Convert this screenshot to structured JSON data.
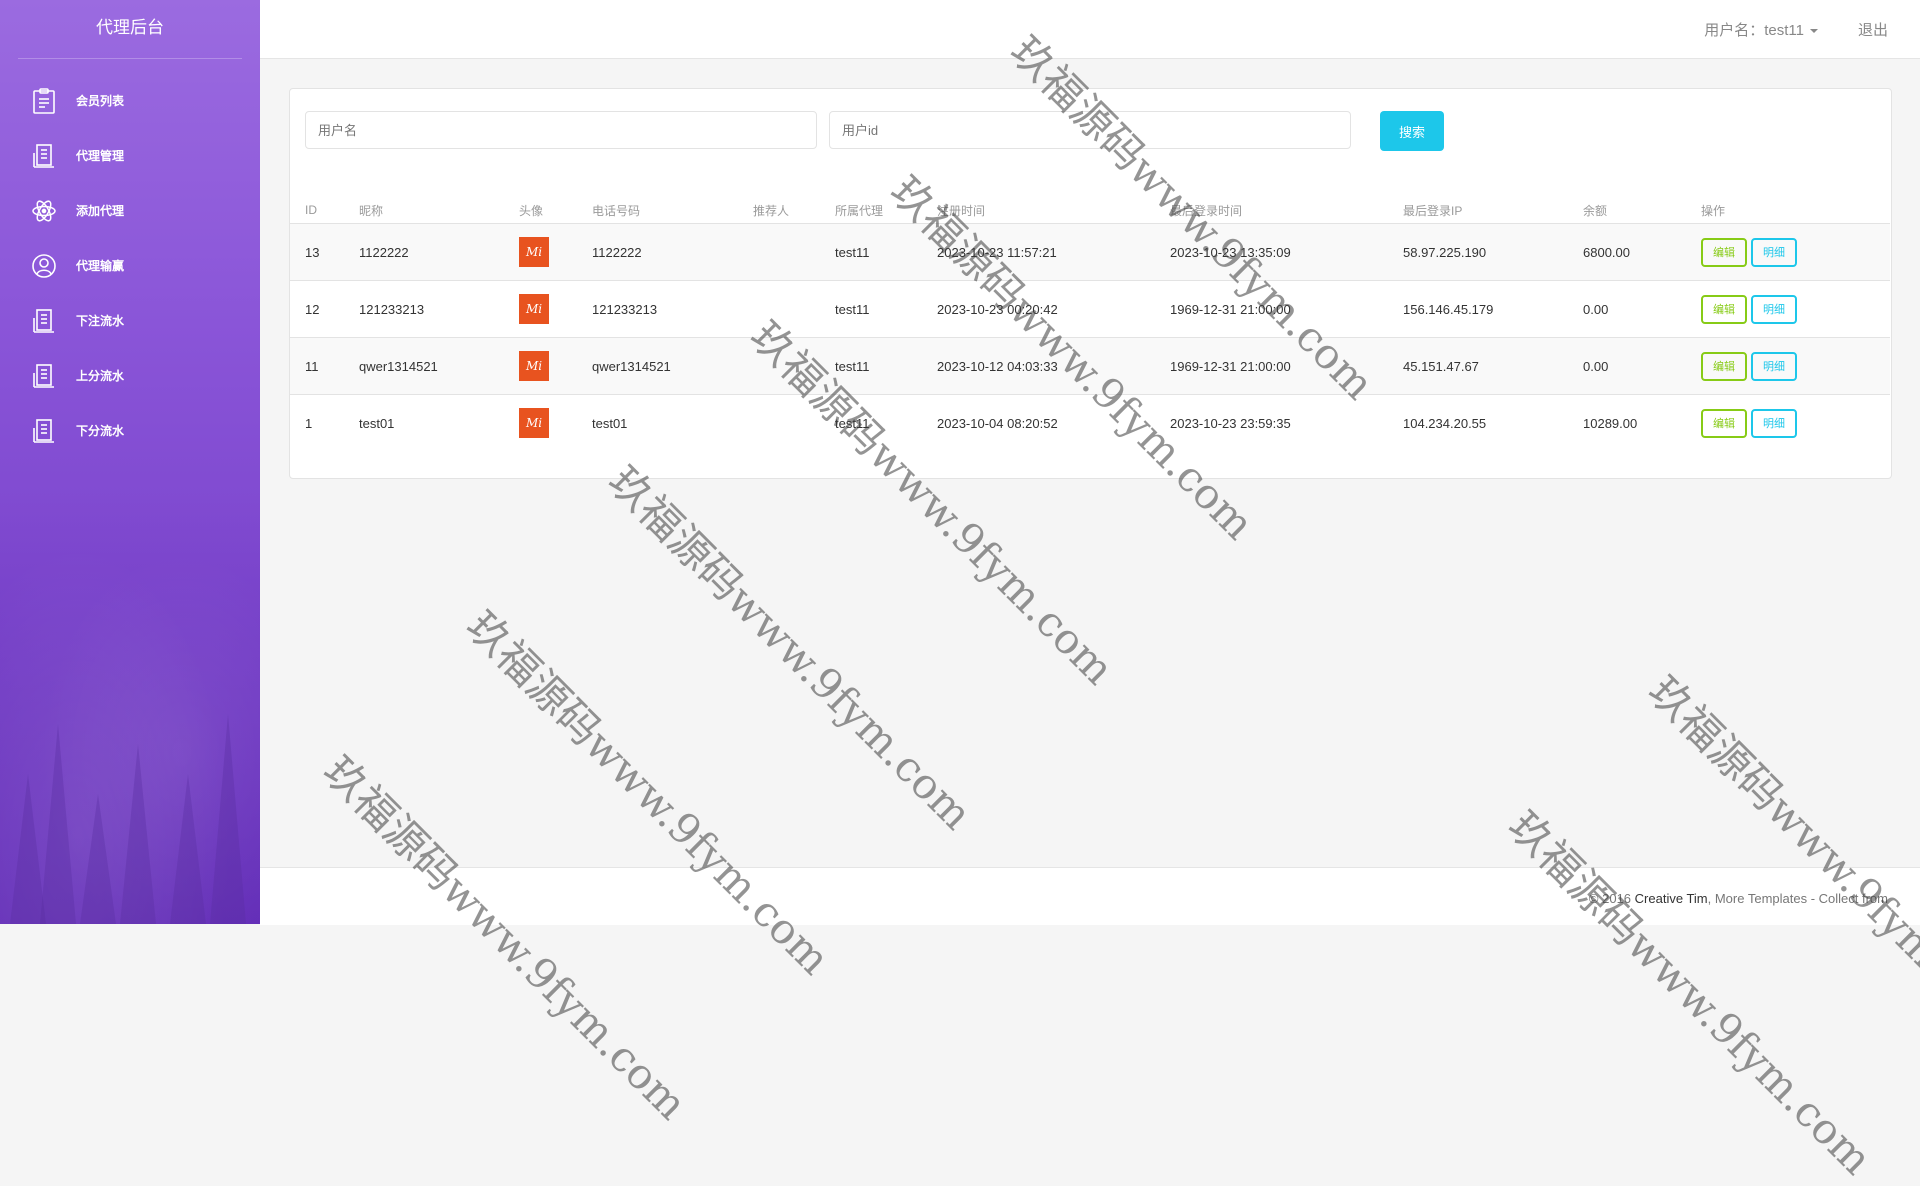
{
  "sidebar": {
    "brand": "代理后台",
    "items": [
      {
        "label": "会员列表",
        "icon": "clipboard-icon"
      },
      {
        "label": "代理管理",
        "icon": "building-icon"
      },
      {
        "label": "添加代理",
        "icon": "atom-icon"
      },
      {
        "label": "代理输赢",
        "icon": "user-circle-icon"
      },
      {
        "label": "下注流水",
        "icon": "building-icon"
      },
      {
        "label": "上分流水",
        "icon": "building-icon"
      },
      {
        "label": "下分流水",
        "icon": "building-icon"
      }
    ]
  },
  "header": {
    "user_label": "用户名：test11",
    "logout": "退出"
  },
  "search": {
    "username_placeholder": "用户名",
    "userid_placeholder": "用户id",
    "button": "搜索"
  },
  "table": {
    "columns": [
      "ID",
      "昵称",
      "头像",
      "电话号码",
      "推荐人",
      "所属代理",
      "注册时间",
      "最后登录时间",
      "最后登录IP",
      "余额",
      "操作"
    ],
    "avatar_text": "Mi",
    "edit_label": "编辑",
    "detail_label": "明细",
    "rows": [
      {
        "id": "13",
        "nickname": "1122222",
        "phone": "1122222",
        "referrer": "",
        "agent": "test11",
        "reg_time": "2023-10-23 11:57:21",
        "last_login": "2023-10-23 13:35:09",
        "ip": "58.97.225.190",
        "balance": "6800.00"
      },
      {
        "id": "12",
        "nickname": "121233213",
        "phone": "121233213",
        "referrer": "",
        "agent": "test11",
        "reg_time": "2023-10-23 00:20:42",
        "last_login": "1969-12-31 21:00:00",
        "ip": "156.146.45.179",
        "balance": "0.00"
      },
      {
        "id": "11",
        "nickname": "qwer1314521",
        "phone": "qwer1314521",
        "referrer": "",
        "agent": "test11",
        "reg_time": "2023-10-12 04:03:33",
        "last_login": "1969-12-31 21:00:00",
        "ip": "45.151.47.67",
        "balance": "0.00"
      },
      {
        "id": "1",
        "nickname": "test01",
        "phone": "test01",
        "referrer": "",
        "agent": "test11",
        "reg_time": "2023-10-04 08:20:52",
        "last_login": "2023-10-23 23:59:35",
        "ip": "104.234.20.55",
        "balance": "10289.00"
      }
    ]
  },
  "footer": {
    "prefix": "© 2016 ",
    "author": "Creative Tim",
    "suffix": ", More Templates - Collect from"
  },
  "watermark": "玖福源码www.9fym.com",
  "colors": {
    "sidebar_top": "#9b6be0",
    "sidebar_bottom": "#6a33c0",
    "search_button": "#1dc7ea",
    "edit_button": "#87cb16",
    "detail_button": "#1dc7ea",
    "avatar": "#e8531f"
  }
}
